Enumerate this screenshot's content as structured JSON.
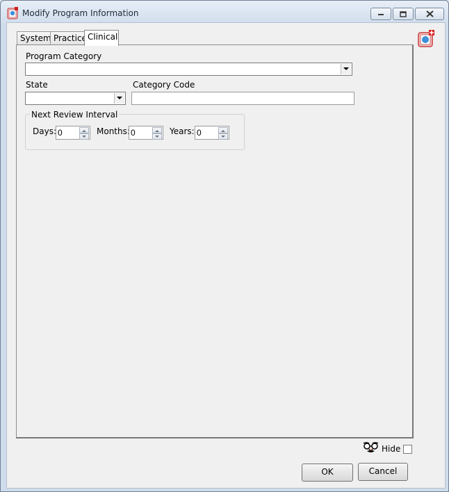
{
  "window": {
    "title": "Modify Program Information",
    "caption_buttons": [
      "minimize-icon",
      "maximize-icon",
      "close-icon"
    ]
  },
  "tabs": [
    {
      "label": "System",
      "active": false
    },
    {
      "label": "Practice",
      "active": false
    },
    {
      "label": "Clinical",
      "active": true
    }
  ],
  "form": {
    "program_category": {
      "label": "Program Category",
      "value": ""
    },
    "state": {
      "label": "State",
      "value": ""
    },
    "category_code": {
      "label": "Category Code",
      "value": ""
    },
    "review_interval": {
      "title": "Next Review Interval",
      "days": {
        "label": "Days:",
        "value": "0"
      },
      "months": {
        "label": "Months:",
        "value": "0"
      },
      "years": {
        "label": "Years:",
        "value": "0"
      }
    }
  },
  "footer": {
    "hide_label": "Hide",
    "hide_checked": false,
    "ok_label": "OK",
    "cancel_label": "Cancel"
  },
  "colors": {
    "accent": "#d94040",
    "frame": "#cfdceb"
  }
}
